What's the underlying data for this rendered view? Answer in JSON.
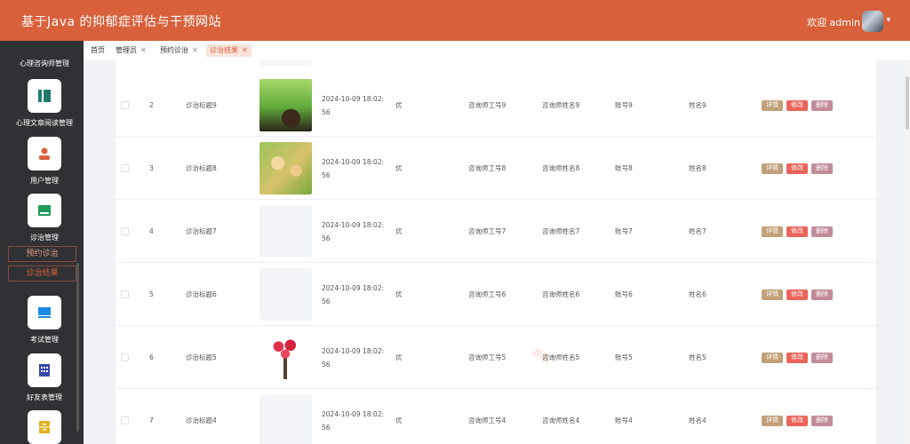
{
  "header": {
    "title": "基于Java 的抑郁症评估与干预网站",
    "welcome": "欢迎 admin"
  },
  "sidebar": {
    "top_label": "心理咨询师管理",
    "items": [
      {
        "label": "心理文章阅读管理",
        "icon": "book-icon",
        "color": "#1f7a6e"
      },
      {
        "label": "用户管理",
        "icon": "user-icon",
        "color": "#d8613c"
      },
      {
        "label": "诊治管理",
        "icon": "card-icon",
        "color": "#1f9a5a"
      },
      {
        "label": "考试管理",
        "icon": "monitor-icon",
        "color": "#1e88e5"
      },
      {
        "label": "好友表管理",
        "icon": "grid-icon",
        "color": "#3949ab"
      },
      {
        "label": "",
        "icon": "cabinet-icon",
        "color": "#e0b020"
      }
    ],
    "subitems": [
      {
        "label": "预约诊治"
      },
      {
        "label": "诊治结果"
      }
    ]
  },
  "tabs": [
    {
      "label": "首页",
      "closable": false
    },
    {
      "label": "管理员",
      "closable": true
    },
    {
      "label": "预约诊治",
      "closable": true
    },
    {
      "label": "诊治结果",
      "closable": true,
      "active": true
    }
  ],
  "table": {
    "actions": {
      "detail": "详情",
      "edit": "修改",
      "delete": "删除"
    },
    "rows": [
      {
        "index": "2",
        "title": "诊治标题9",
        "image": "sprout",
        "datetime": "2024-10-09 18:02:56",
        "rating": "优",
        "counselor_id": "咨询师工号9",
        "counselor_name": "咨询师姓名9",
        "account": "账号9",
        "name": "姓名9"
      },
      {
        "index": "3",
        "title": "诊治标题8",
        "image": "hearts",
        "datetime": "2024-10-09 18:02:56",
        "rating": "优",
        "counselor_id": "咨询师工号8",
        "counselor_name": "咨询师姓名8",
        "account": "账号8",
        "name": "姓名8"
      },
      {
        "index": "4",
        "title": "诊治标题7",
        "image": "blank",
        "datetime": "2024-10-09 18:02:56",
        "rating": "优",
        "counselor_id": "咨询师工号7",
        "counselor_name": "咨询师姓名7",
        "account": "账号7",
        "name": "姓名7"
      },
      {
        "index": "5",
        "title": "诊治标题6",
        "image": "blank",
        "datetime": "2024-10-09 18:02:56",
        "rating": "优",
        "counselor_id": "咨询师工号6",
        "counselor_name": "咨询师姓名6",
        "account": "账号6",
        "name": "姓名6"
      },
      {
        "index": "6",
        "title": "诊治标题5",
        "image": "tree",
        "datetime": "2024-10-09 18:02:56",
        "rating": "优",
        "counselor_id": "咨询师工号5",
        "counselor_name": "咨询师姓名5",
        "account": "账号5",
        "name": "姓名5"
      },
      {
        "index": "7",
        "title": "诊治标题4",
        "image": "blank",
        "datetime": "2024-10-09 18:02:56",
        "rating": "优",
        "counselor_id": "咨询师工号4",
        "counselor_name": "咨询师姓名4",
        "account": "账号4",
        "name": "姓名4"
      }
    ]
  },
  "colors": {
    "accent": "#d8613c",
    "sidebar_bg": "#2f3134"
  }
}
